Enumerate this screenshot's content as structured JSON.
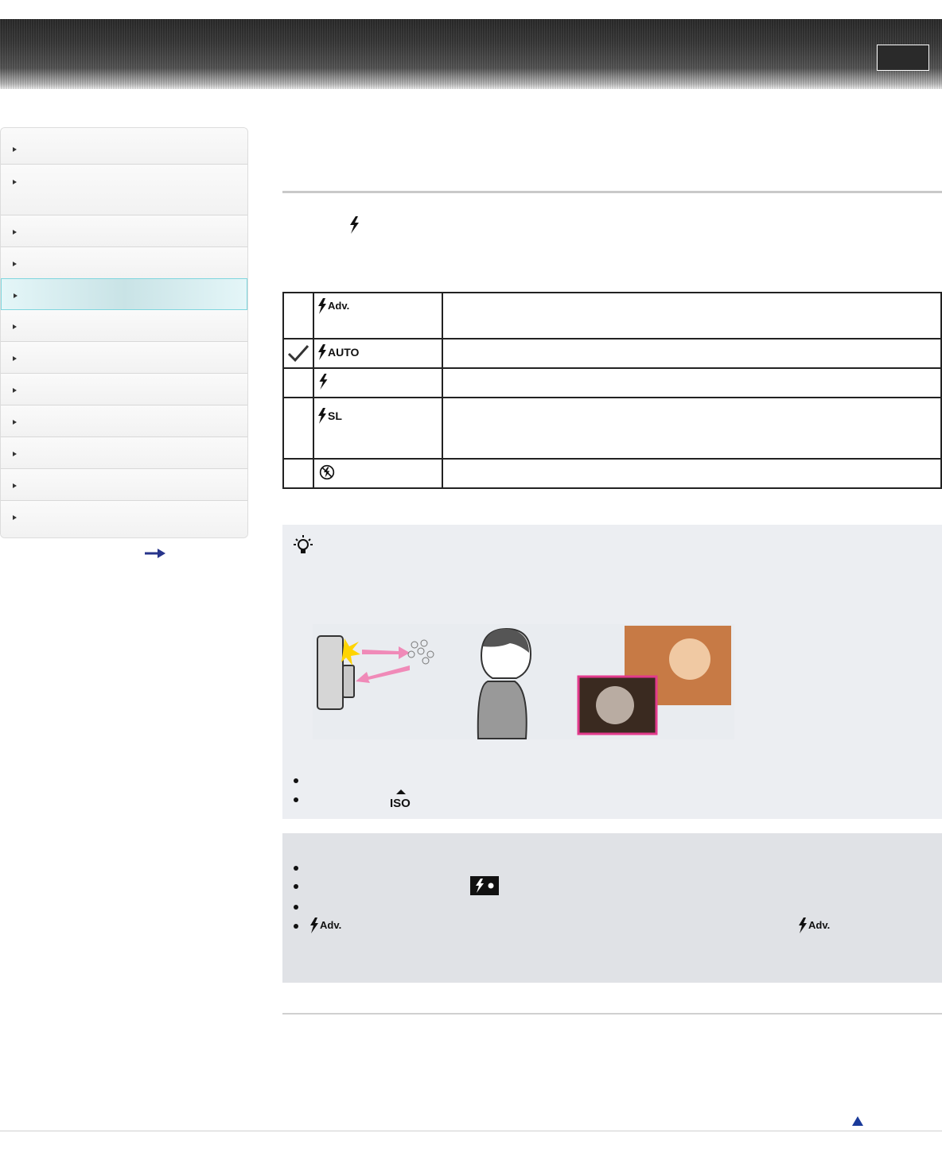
{
  "header": {
    "button_label": ""
  },
  "sidebar": {
    "items": [
      {
        "label": ""
      },
      {
        "label": ""
      },
      {
        "label": ""
      },
      {
        "label": ""
      },
      {
        "label": ""
      },
      {
        "label": ""
      },
      {
        "label": ""
      },
      {
        "label": ""
      },
      {
        "label": ""
      },
      {
        "label": ""
      },
      {
        "label": ""
      },
      {
        "label": ""
      }
    ],
    "active_index": 4
  },
  "page": {
    "title": "",
    "intro": ""
  },
  "flash_modes": [
    {
      "icon": "flash-advanced-icon",
      "icon_text": "Adv.",
      "selected": false,
      "description": ""
    },
    {
      "icon": "flash-auto-icon",
      "icon_text": "AUTO",
      "selected": true,
      "description": ""
    },
    {
      "icon": "flash-on-icon",
      "icon_text": "",
      "selected": false,
      "description": ""
    },
    {
      "icon": "flash-slow-sync-icon",
      "icon_text": "SL",
      "selected": false,
      "description": ""
    },
    {
      "icon": "flash-off-icon",
      "icon_text": "",
      "selected": false,
      "description": ""
    }
  ],
  "hint": {
    "title": "",
    "paragraph": "",
    "bullets": [
      {
        "text": ""
      },
      {
        "text": "",
        "icon": "iso-icon"
      }
    ]
  },
  "notes": {
    "title": "",
    "bullets": [
      {
        "text": ""
      },
      {
        "text": "",
        "icon": "flash-charging-icon"
      },
      {
        "text": ""
      },
      {
        "text": "",
        "icon": "flash-advanced-icon",
        "icon_text": "Adv."
      }
    ]
  },
  "colors": {
    "active_nav": "#cfe9ec",
    "hint_bg": "#eceef2",
    "note_bg": "#e0e2e6",
    "top_arrow": "#1a3a9a"
  }
}
